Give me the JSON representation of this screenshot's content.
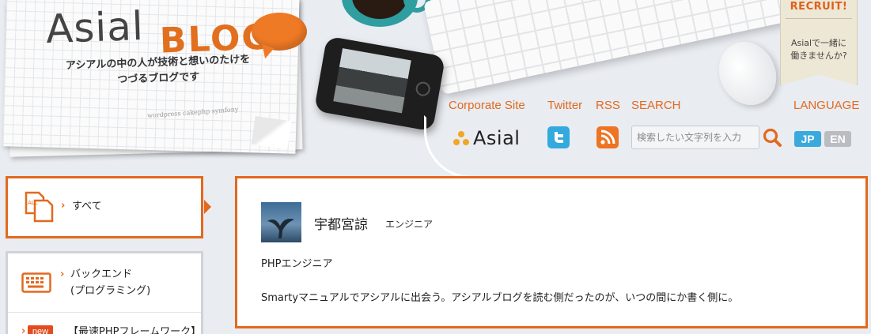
{
  "header": {
    "logo_asial": "Asial",
    "logo_blog": "BLOG",
    "tagline_line1": "アシアルの中の人が技術と想いのたけを",
    "tagline_line2": "つづるブログです",
    "notepad_scribble": "wordpress  cakephp  symfony"
  },
  "recruit": {
    "title": "RECRUIT!",
    "text_line1": "Asialで一緒に",
    "text_line2": "働きませんか?"
  },
  "nav": {
    "corporate_site": "Corporate Site",
    "twitter": "Twitter",
    "rss": "RSS",
    "search": "SEARCH",
    "language": "LANGUAGE",
    "asial_logo_text": "Asial",
    "search_placeholder": "検索したい文字列を入力",
    "lang_jp": "JP",
    "lang_en": "EN"
  },
  "sidebar": {
    "all": {
      "label": "すべて",
      "icon_text": "ALL"
    },
    "items": [
      {
        "label_line1": "バックエンド",
        "label_line2": "(プログラミング)"
      },
      {
        "badge": "new",
        "label": "【最速PHPフレームワーク】"
      }
    ]
  },
  "author": {
    "name": "宇都宮諒",
    "role": "エンジニア",
    "title": "PHPエンジニア",
    "bio": "Smartyマニュアルでアシアルに出会う。アシアルブログを読む側だったのが、いつの間にか書く側に。"
  },
  "colors": {
    "accent": "#e2691e",
    "twitter": "#33a9de",
    "rss": "#ee7322",
    "lang_active": "#3aa9dc",
    "lang_inactive": "#b9bdc2",
    "background": "#e9ecf1"
  },
  "icons": {
    "search": "search-icon",
    "twitter": "twitter-icon",
    "rss": "rss-icon",
    "all": "all-documents-icon",
    "backend": "keyboard-icon",
    "chevron": "chevron-right-icon"
  }
}
